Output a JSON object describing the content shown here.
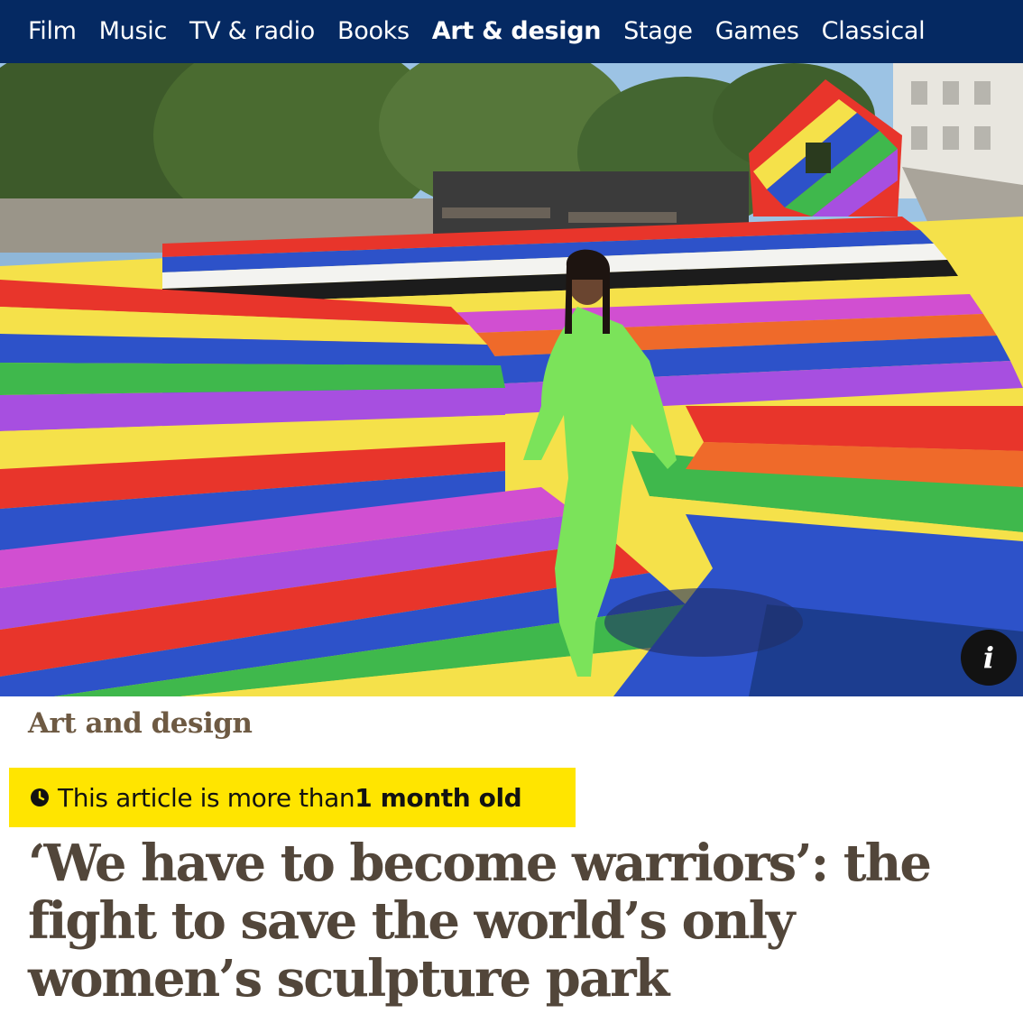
{
  "nav": {
    "items": [
      {
        "label": "Film",
        "active": false
      },
      {
        "label": "Music",
        "active": false
      },
      {
        "label": "TV & radio",
        "active": false
      },
      {
        "label": "Books",
        "active": false
      },
      {
        "label": "Art & design",
        "active": true
      },
      {
        "label": "Stage",
        "active": false
      },
      {
        "label": "Games",
        "active": false
      },
      {
        "label": "Classical",
        "active": false
      }
    ]
  },
  "hero": {
    "info_icon": "i"
  },
  "article": {
    "section": "Art and design",
    "age_warning": {
      "prefix": "This article is more than ",
      "emphasis": "1 month old"
    },
    "headline": "‘We have to become warriors’: the fight to save the world’s only women’s sculpture park"
  },
  "colors": {
    "nav_background": "#052962",
    "section_label": "#6e5a43",
    "age_warning_background": "#ffe500",
    "headline": "#52463a"
  }
}
